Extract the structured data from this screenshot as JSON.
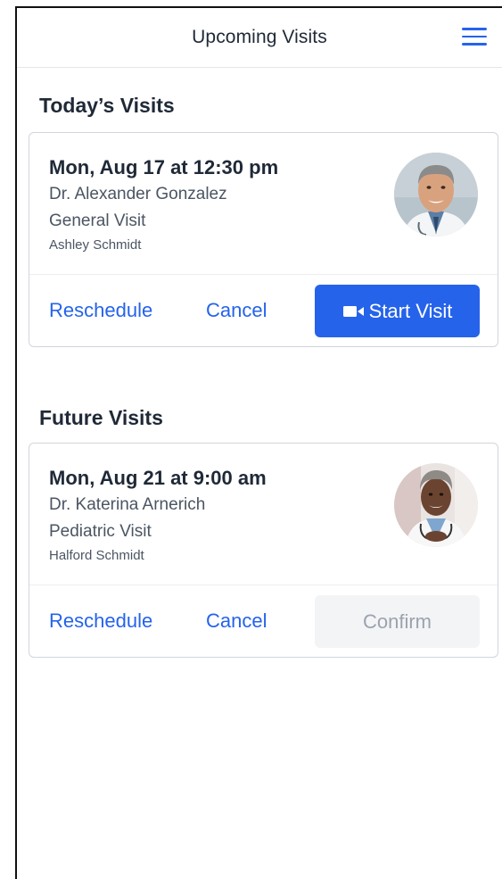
{
  "header": {
    "title": "Upcoming Visits",
    "menu_icon": "menu-icon"
  },
  "colors": {
    "accent": "#2563eb",
    "text_primary": "#1f2937",
    "text_secondary": "#4b5563",
    "disabled_bg": "#f3f4f6",
    "disabled_text": "#9ca3af"
  },
  "today": {
    "section_title": "Today’s Visits",
    "visit": {
      "datetime": "Mon, Aug 17 at 12:30 pm",
      "doctor": "Dr. Alexander Gonzalez",
      "type": "General Visit",
      "patient": "Ashley Schmidt",
      "reschedule_label": "Reschedule",
      "cancel_label": "Cancel",
      "start_label": "Start Visit",
      "start_icon": "video-camera-icon"
    }
  },
  "future": {
    "section_title": "Future Visits",
    "visit": {
      "datetime": "Mon, Aug 21 at 9:00 am",
      "doctor": "Dr. Katerina Arnerich",
      "type": "Pediatric Visit",
      "patient": "Halford Schmidt",
      "reschedule_label": "Reschedule",
      "cancel_label": "Cancel",
      "confirm_label": "Confirm"
    }
  }
}
